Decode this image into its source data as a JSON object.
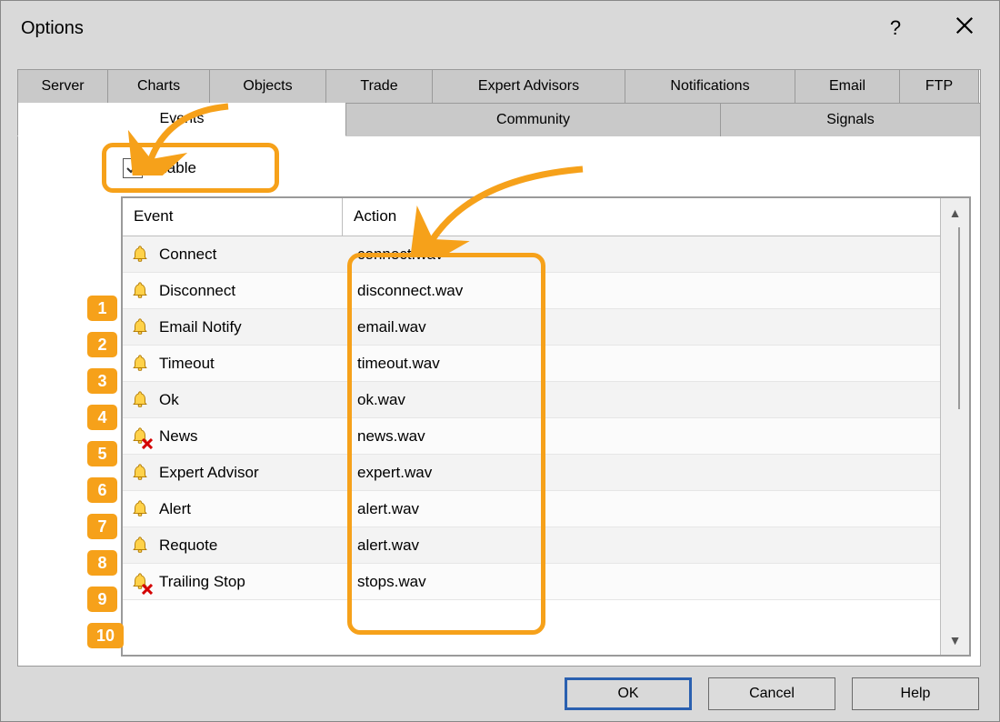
{
  "window": {
    "title": "Options"
  },
  "tabs_row1": [
    {
      "label": "Server"
    },
    {
      "label": "Charts"
    },
    {
      "label": "Objects"
    },
    {
      "label": "Trade"
    },
    {
      "label": "Expert Advisors"
    },
    {
      "label": "Notifications"
    },
    {
      "label": "Email"
    },
    {
      "label": "FTP"
    }
  ],
  "tabs_row2": [
    {
      "label": "Events",
      "active": true
    },
    {
      "label": "Community"
    },
    {
      "label": "Signals"
    }
  ],
  "enable": {
    "label": "Enable",
    "checked": true
  },
  "table": {
    "columns": {
      "event": "Event",
      "action": "Action"
    },
    "rows": [
      {
        "n": "1",
        "event": "Connect",
        "action": "connect.wav",
        "muted": false
      },
      {
        "n": "2",
        "event": "Disconnect",
        "action": "disconnect.wav",
        "muted": false
      },
      {
        "n": "3",
        "event": "Email Notify",
        "action": "email.wav",
        "muted": false
      },
      {
        "n": "4",
        "event": "Timeout",
        "action": "timeout.wav",
        "muted": false
      },
      {
        "n": "5",
        "event": "Ok",
        "action": "ok.wav",
        "muted": false
      },
      {
        "n": "6",
        "event": "News",
        "action": "news.wav",
        "muted": true
      },
      {
        "n": "7",
        "event": "Expert Advisor",
        "action": "expert.wav",
        "muted": false
      },
      {
        "n": "8",
        "event": "Alert",
        "action": "alert.wav",
        "muted": false
      },
      {
        "n": "9",
        "event": "Requote",
        "action": "alert.wav",
        "muted": false
      },
      {
        "n": "10",
        "event": "Trailing Stop",
        "action": "stops.wav",
        "muted": true
      }
    ]
  },
  "buttons": {
    "ok": "OK",
    "cancel": "Cancel",
    "help": "Help"
  }
}
